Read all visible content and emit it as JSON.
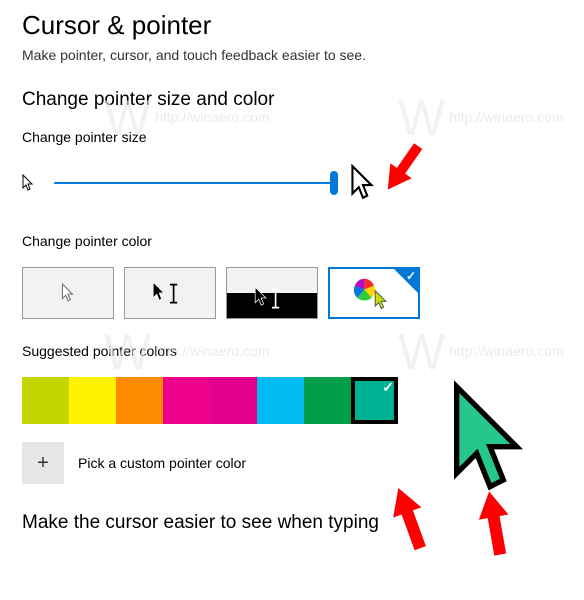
{
  "page": {
    "title": "Cursor & pointer",
    "subtitle": "Make pointer, cursor, and touch feedback easier to see."
  },
  "section_size_color": {
    "heading": "Change pointer size and color",
    "size_label": "Change pointer size",
    "slider_value": 100,
    "slider_min": 0,
    "slider_max": 100,
    "color_label": "Change pointer color",
    "options": [
      {
        "name": "white",
        "selected": false
      },
      {
        "name": "black",
        "selected": false
      },
      {
        "name": "inverted",
        "selected": false
      },
      {
        "name": "custom",
        "selected": true
      }
    ]
  },
  "suggested": {
    "label": "Suggested pointer colors",
    "swatches": [
      {
        "color": "#c4d600",
        "selected": false
      },
      {
        "color": "#fff100",
        "selected": false
      },
      {
        "color": "#ff8c00",
        "selected": false
      },
      {
        "color": "#ec008c",
        "selected": false
      },
      {
        "color": "#e3008c",
        "selected": false
      },
      {
        "color": "#00bcf2",
        "selected": false
      },
      {
        "color": "#009e49",
        "selected": false
      },
      {
        "color": "#00b294",
        "selected": true
      }
    ],
    "pick_button": "+",
    "pick_label": "Pick a custom pointer color"
  },
  "section_cursor": {
    "heading": "Make the cursor easier to see when typing"
  },
  "watermark": {
    "url": "http://winaero.com",
    "logo": "W"
  }
}
